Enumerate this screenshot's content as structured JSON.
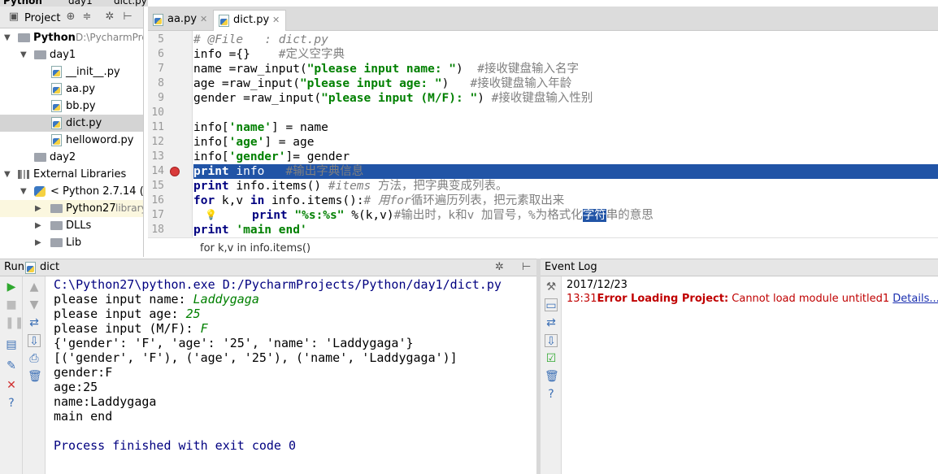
{
  "breadcrumbs": [
    "Python",
    "day1",
    "dict.py"
  ],
  "project_panel": {
    "title": "Project",
    "tree": [
      {
        "label": "Python",
        "path": "D:\\PycharmPro",
        "type": "folder",
        "expanded": true
      },
      {
        "label": "day1",
        "type": "folder",
        "expanded": true
      },
      {
        "label": "__init__.py",
        "type": "py"
      },
      {
        "label": "aa.py",
        "type": "py"
      },
      {
        "label": "bb.py",
        "type": "py"
      },
      {
        "label": "dict.py",
        "type": "py",
        "selected": true
      },
      {
        "label": "helloword.py",
        "type": "py"
      },
      {
        "label": "day2",
        "type": "folder"
      },
      {
        "label": "External Libraries",
        "type": "lib",
        "expanded": true
      },
      {
        "label": "< Python 2.7.14 (C:\\",
        "type": "pyenv",
        "expanded": true
      },
      {
        "label": "Python27",
        "path": "library",
        "type": "folder"
      },
      {
        "label": "DLLs",
        "type": "folder"
      },
      {
        "label": "Lib",
        "type": "folder"
      }
    ]
  },
  "tabs": [
    {
      "label": "aa.py",
      "active": false
    },
    {
      "label": "dict.py",
      "active": true
    }
  ],
  "editor": {
    "line_numbers": [
      "5",
      "6",
      "7",
      "8",
      "9",
      "10",
      "11",
      "12",
      "13",
      "14",
      "15",
      "16",
      "17",
      "18"
    ],
    "code": {
      "l5_cm": "# @File   : dict.py",
      "l6_a": "info ={}",
      "l6_cm": "    #定义空字典",
      "l7_a": "name =raw_input(",
      "l7_s": "\"please input name: \"",
      "l7_b": ")  ",
      "l7_cm": "#接收键盘输入名字",
      "l8_a": "age =raw_input(",
      "l8_s": "\"please input age: \"",
      "l8_b": ")   ",
      "l8_cm": "#接收键盘输入年龄",
      "l9_a": "gender =raw_input(",
      "l9_s": "\"please input (M/F): \"",
      "l9_b": ") ",
      "l9_cm": "#接收键盘输入性别",
      "l11_a": "info[",
      "l11_s": "'name'",
      "l11_b": "] = name",
      "l12_a": "info[",
      "l12_s": "'age'",
      "l12_b": "] = age",
      "l13_a": "info[",
      "l13_s": "'gender'",
      "l13_b": "]= gender",
      "l14_kw": "print",
      "l14_a": " info   ",
      "l14_cm": "#输出字典信息",
      "l15_kw": "print",
      "l15_a": " info.items() ",
      "l15_cm": "#items",
      "l15_cm2": " 方法，把字典变成列表。",
      "l16_kw": "for",
      "l16_a": " k,v ",
      "l16_kw2": "in",
      "l16_b": " info.items():",
      "l16_cm": "# 用for",
      "l16_cm2": "循环遍历列表，把元素取出来",
      "l17_kw": "print",
      "l17_s": "\"%s:%s\"",
      "l17_a": " %(k,v)",
      "l17_cm": "#输出时，k和v 加冒号，%为格式化",
      "l17_sel": "字符",
      "l17_cm2": "串的意思",
      "l18_kw": "print",
      "l18_s": "'main end'"
    },
    "breadcrumb": "for k,v in info.items()"
  },
  "run_panel": {
    "title": "Run",
    "config": "dict",
    "output": {
      "cmd": "C:\\Python27\\python.exe D:/PycharmProjects/Python/day1/dict.py",
      "p1": "please input name: ",
      "i1": "Laddygaga",
      "p2": "please input age: ",
      "i2": "25",
      "p3": "please input (M/F): ",
      "i3": "F",
      "o1": "{'gender': 'F', 'age': '25', 'name': 'Laddygaga'}",
      "o2": "[('gender', 'F'), ('age', '25'), ('name', 'Laddygaga')]",
      "o3": "gender:F",
      "o4": "age:25",
      "o5": "name:Laddygaga",
      "o6": "main end",
      "finish": "Process finished with exit code 0"
    }
  },
  "event_log": {
    "title": "Event Log",
    "date": "2017/12/23",
    "time": "13:31",
    "error_title": "Error Loading Project:",
    "error_text": " Cannot load module untitled1 ",
    "link": "Details..."
  },
  "colors": {
    "selection": "#2154a6",
    "keyword": "#000080",
    "string": "#008000",
    "comment": "#808080",
    "error": "#c00000"
  }
}
